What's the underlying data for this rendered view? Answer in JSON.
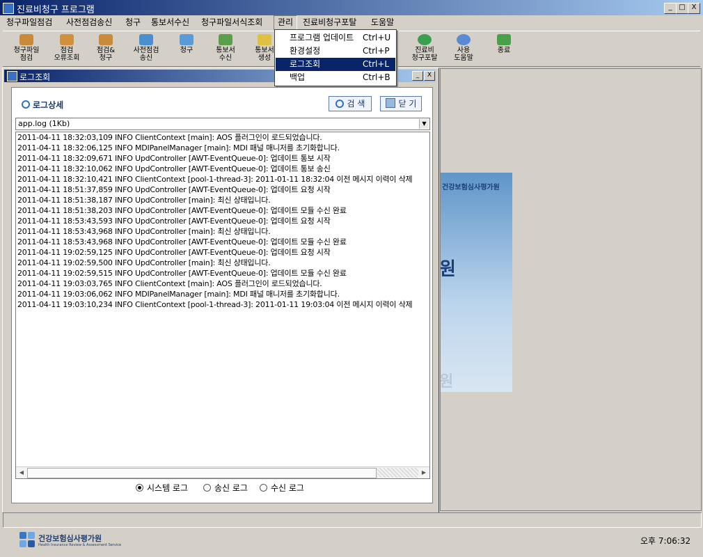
{
  "window": {
    "title": "진료비청구 프로그램",
    "buttons": [
      "_",
      "□",
      "X"
    ]
  },
  "menu": [
    "청구파일점검",
    "사전점검송신",
    "청구",
    "통보서수신",
    "청구파일서식조회",
    "관리",
    "진료비청구포탈",
    "도움말"
  ],
  "menu_active": "관리",
  "dropdown": [
    {
      "label": "프로그램 업데이트",
      "shortcut": "Ctrl+U"
    },
    {
      "label": "환경설정",
      "shortcut": "Ctrl+P"
    },
    {
      "label": "로그조회",
      "shortcut": "Ctrl+L"
    },
    {
      "label": "백업",
      "shortcut": "Ctrl+B"
    }
  ],
  "dropdown_highlighted": "로그조회",
  "toolbar": [
    {
      "l1": "청구파일",
      "l2": "점검",
      "icon": "file-check-icon",
      "color": "#c98a3a"
    },
    {
      "l1": "점검",
      "l2": "오류조회",
      "icon": "error-search-icon",
      "color": "#d0903c"
    },
    {
      "l1": "점검&",
      "l2": "청구",
      "icon": "check-claim-icon",
      "color": "#c98a3a"
    },
    {
      "l1": "사전점검",
      "l2": "송신",
      "icon": "precheck-send-icon",
      "color": "#4a8fd0"
    },
    {
      "l1": "청구",
      "l2": "",
      "icon": "claim-icon",
      "color": "#5a9ad6"
    },
    {
      "l1": "통보서",
      "l2": "수신",
      "icon": "notice-receive-icon",
      "color": "#5aa04a"
    },
    {
      "l1": "통보서",
      "l2": "생성",
      "icon": "notice-create-icon",
      "color": "#e0c040"
    },
    {
      "l1": "진료비",
      "l2": "청구포탈",
      "icon": "portal-icon",
      "color": "#3aa050"
    },
    {
      "l1": "사용",
      "l2": "도움말",
      "icon": "help-icon",
      "color": "#5a8ad6"
    },
    {
      "l1": "종료",
      "l2": "",
      "icon": "exit-icon",
      "color": "#4aa048"
    }
  ],
  "child_window": {
    "title": "로그조회",
    "buttons": [
      "_",
      "X"
    ]
  },
  "panel": {
    "section_title": "로그상세",
    "search_label": "검 색",
    "close_label": "닫 기",
    "file_select": "app.log (1Kb)"
  },
  "log_lines": [
    "2011-04-11 18:32:03,109 INFO  ClientContext [main]: AOS 플러그인이 로드되었습니다.",
    "2011-04-11 18:32:06,125 INFO  MDIPanelManager [main]: MDI 패널 매니저를 초기화합니다.",
    "2011-04-11 18:32:09,671 INFO  UpdController [AWT-EventQueue-0]: 업데이트 통보 시작",
    "2011-04-11 18:32:10,062 INFO  UpdController [AWT-EventQueue-0]: 업데이트 통보 송신",
    "2011-04-11 18:32:10,421 INFO  ClientContext [pool-1-thread-3]: 2011-01-11 18:32:04 이전 메시지 이력이 삭제",
    "2011-04-11 18:51:37,859 INFO  UpdController [AWT-EventQueue-0]: 업데이트 요청 시작",
    "2011-04-11 18:51:38,187 INFO  UpdController [main]: 최신 상태입니다.",
    "2011-04-11 18:51:38,203 INFO  UpdController [AWT-EventQueue-0]: 업데이트 모듈 수신 완료",
    "2011-04-11 18:53:43,593 INFO  UpdController [AWT-EventQueue-0]: 업데이트 요청 시작",
    "2011-04-11 18:53:43,968 INFO  UpdController [main]: 최신 상태입니다.",
    "2011-04-11 18:53:43,968 INFO  UpdController [AWT-EventQueue-0]: 업데이트 모듈 수신 완료",
    "2011-04-11 19:02:59,125 INFO  UpdController [AWT-EventQueue-0]: 업데이트 요청 시작",
    "2011-04-11 19:02:59,500 INFO  UpdController [main]: 최신 상태입니다.",
    "2011-04-11 19:02:59,515 INFO  UpdController [AWT-EventQueue-0]: 업데이트 모듈 수신 완료",
    "2011-04-11 19:03:03,765 INFO  ClientContext [main]: AOS 플러그인이 로드되었습니다.",
    "2011-04-11 19:03:06,062 INFO  MDIPanelManager [main]: MDI 패널 매니저를 초기화합니다.",
    "2011-04-11 19:03:10,234 INFO  ClientContext [pool-1-thread-3]: 2011-01-11 19:03:04 이전 메시지 이력이 삭제"
  ],
  "radios": [
    {
      "label": "시스템 로그",
      "checked": true
    },
    {
      "label": "송신 로그",
      "checked": false
    },
    {
      "label": "수신 로그",
      "checked": false
    }
  ],
  "splash": {
    "org_small": "건강보험심사평가원",
    "big_char": "원",
    "faded_char": "원"
  },
  "footer": {
    "org_name": "건강보험심사평가원",
    "org_sub": "Health Insurance Review & Assessment Service",
    "clock": "오후 7:06:32"
  }
}
